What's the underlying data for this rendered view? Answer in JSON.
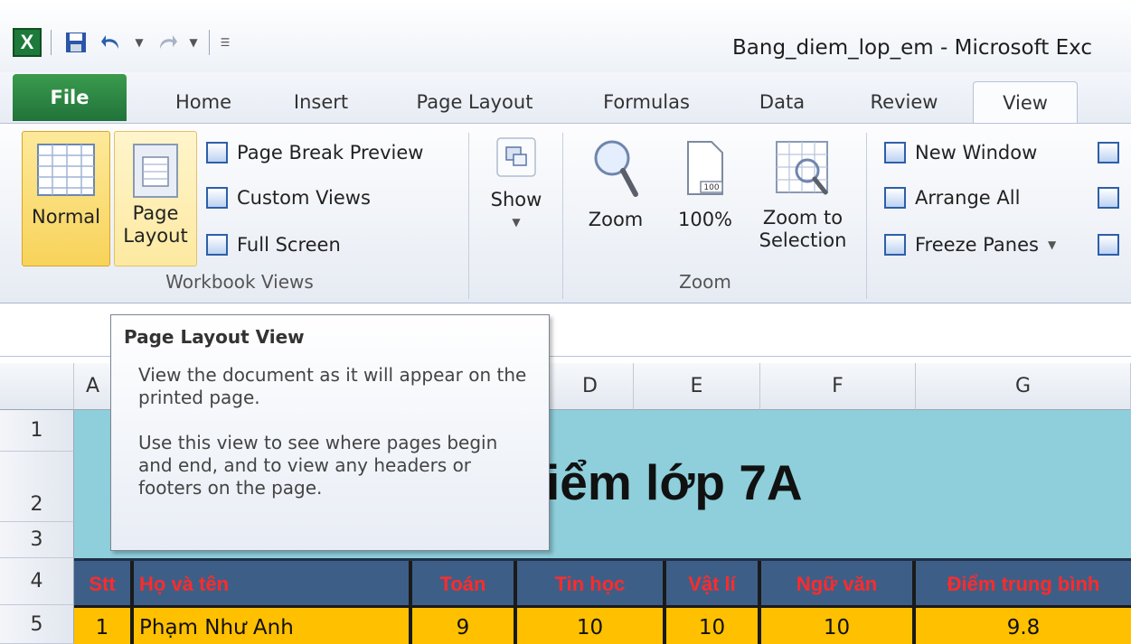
{
  "window": {
    "title": "Bang_diem_lop_em - Microsoft Exc"
  },
  "qat": {
    "logo": "X"
  },
  "tabs": [
    {
      "label": "File"
    },
    {
      "label": "Home"
    },
    {
      "label": "Insert"
    },
    {
      "label": "Page Layout"
    },
    {
      "label": "Formulas"
    },
    {
      "label": "Data"
    },
    {
      "label": "Review"
    },
    {
      "label": "View",
      "active": true
    }
  ],
  "ribbon": {
    "workbook_views": {
      "label": "Workbook Views",
      "normal": "Normal",
      "page_layout_line1": "Page",
      "page_layout_line2": "Layout",
      "page_break_preview": "Page Break Preview",
      "custom_views": "Custom Views",
      "full_screen": "Full Screen"
    },
    "show": {
      "label": "Show"
    },
    "zoom": {
      "label": "Zoom",
      "zoom": "Zoom",
      "hundred": "100%",
      "zoom_to_line1": "Zoom to",
      "zoom_to_line2": "Selection",
      "icon_text": "100"
    },
    "window": {
      "new_window": "New Window",
      "arrange_all": "Arrange All",
      "freeze_panes": "Freeze Panes"
    }
  },
  "tooltip": {
    "title": "Page Layout View",
    "p1": "View the document as it will appear on the printed page.",
    "p2": "Use this view to see where pages begin and end, and to view any headers or footers on the page."
  },
  "columns": [
    "A",
    "D",
    "E",
    "F",
    "G"
  ],
  "rows": [
    "1",
    "2",
    "3",
    "4",
    "5"
  ],
  "sheet": {
    "title_visible": "iểm lớp 7A",
    "headers": [
      "Stt",
      "Họ và tên",
      "Toán",
      "Tin học",
      "Vật lí",
      "Ngữ văn",
      "Điểm trung bình"
    ],
    "row5": [
      "1",
      "Phạm Như Anh",
      "9",
      "10",
      "10",
      "10",
      "9.8"
    ]
  },
  "colors": {
    "accent_file": "#21733a",
    "title_band": "#8ecfdb",
    "header_band": "#3d5f87",
    "header_text": "#ff2b2b",
    "data_row": "#ffc000"
  }
}
